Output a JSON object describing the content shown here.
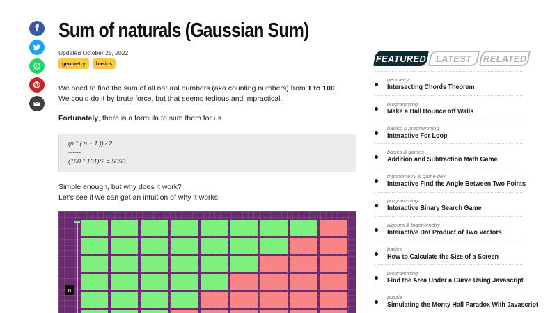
{
  "share": {
    "facebook_icon": "facebook-icon",
    "twitter_icon": "twitter-icon",
    "whatsapp_icon": "whatsapp-icon",
    "pinterest_icon": "pinterest-icon",
    "email_icon": "email-icon",
    "colors": {
      "facebook": "#3b5998",
      "twitter": "#1da1f2",
      "whatsapp": "#25d366",
      "pinterest": "#cb2027",
      "email": "#3f3f3f"
    }
  },
  "article": {
    "title": "Sum of naturals (Gaussian Sum)",
    "updated": "Updated October 25, 2022",
    "tags": [
      "geometry",
      "basics"
    ],
    "intro_before": "We need to find the sum of all natural numbers (aka counting numbers) from ",
    "intro_bold": "1 to 100",
    "intro_after": ".",
    "intro_line2": "We could do it by brute force, but that seems tedious and impractical.",
    "fortunately_bold": "Fortunately",
    "fortunately_rest": ", there is a formula to sum them for us.",
    "code_lines": [
      "(n * ( n + 1 )) / 2",
      "------",
      "(100 * 101)/2 = 5050"
    ],
    "simple_line1": "Simple enough, but why does it work?",
    "simple_line2": "Let's see if we can get an intuition of why it works.",
    "illustration": {
      "n_label": "n",
      "bg_color": "#6a2a6f",
      "green": "#7df07d",
      "red": "#f88486",
      "green_counts_per_row": [
        8,
        7,
        6,
        5,
        4,
        3
      ],
      "row_cells": 9
    }
  },
  "sidebar": {
    "tabs": [
      "FEATURED",
      "LATEST",
      "RELATED"
    ],
    "active_tab": "FEATURED",
    "items": [
      {
        "category": "geometry",
        "title": "Intersecting Chords Theorem"
      },
      {
        "category": "programming",
        "title": "Make a Ball Bounce off Walls"
      },
      {
        "category": "basics & programming",
        "title": "Interactive For Loop"
      },
      {
        "category": "basics & games",
        "title": "Addition and Subtraction Math Game"
      },
      {
        "category": "trigonometry & game dev",
        "title": "Interactive Find the Angle Between Two Points"
      },
      {
        "category": "programming",
        "title": "Interactive Binary Search Game"
      },
      {
        "category": "algebra & trigonometry",
        "title": "Interactive Dot Product of Two Vectors"
      },
      {
        "category": "basics",
        "title": "How to Calculate the Size of a Screen"
      },
      {
        "category": "programming",
        "title": "Find the Area Under a Curve Using Javascript"
      },
      {
        "category": "puzzle",
        "title": "Simulating the Monty Hall Paradox With Javascript"
      }
    ]
  }
}
